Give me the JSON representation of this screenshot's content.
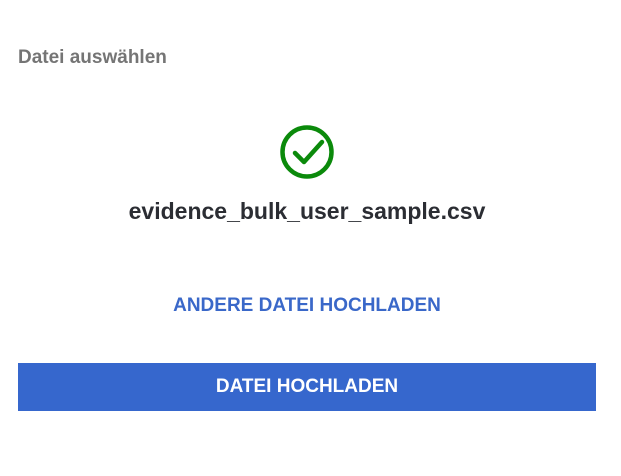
{
  "section": {
    "label": "Datei auswählen"
  },
  "upload": {
    "status_icon": "check-circle-icon",
    "file_name": "evidence_bulk_user_sample.csv",
    "change_file_label": "ANDERE DATEI HOCHLADEN",
    "submit_label": "DATEI HOCHLADEN"
  },
  "colors": {
    "success": "#0b8a0b",
    "accent": "#3667cd",
    "label": "#757575",
    "text": "#2b2d33"
  }
}
